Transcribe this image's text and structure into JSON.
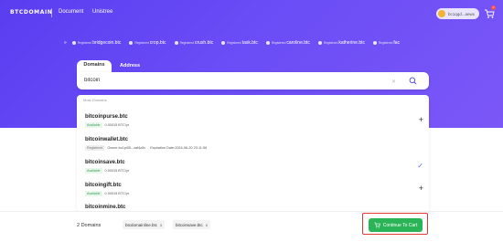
{
  "nav": {
    "logo": "BTCDOMAIN",
    "links": [
      "Document",
      "Unistree"
    ],
    "wallet": "bc1qqd...aewx",
    "cart_count": "2"
  },
  "ticker": {
    "start_mark": "»",
    "prefix": "Registered",
    "names": [
      "bridgecoin.btc",
      "crop.btc",
      "crush.btc",
      "task.btc",
      "caroline.btc",
      "katherine.btc",
      "fac"
    ]
  },
  "tabs": [
    "Domains",
    "Address"
  ],
  "search": {
    "value": "bitcoin",
    "clear_icon": "close-icon",
    "search_icon": "magnifier-icon"
  },
  "results": {
    "header": "Most Domains",
    "rows": [
      {
        "name": "bitcoinpurse.btc",
        "tag": "Available",
        "meta": [
          "0.00015 BTC/yr"
        ],
        "action": "+"
      },
      {
        "name": "bitcoinwallet.btc",
        "tag": "Registered",
        "meta": [
          "Owner:bc1p4l5...zaf4z6v",
          "Expiration Date:2024-06-20 23:11:56"
        ],
        "action": ""
      },
      {
        "name": "bitcoinsave.btc",
        "tag": "Available",
        "meta": [
          "0.00015 BTC/yr"
        ],
        "action": "✓"
      },
      {
        "name": "bitcoingift.btc",
        "tag": "Available",
        "meta": [
          "0.00015 BTC/yr"
        ],
        "action": "+"
      },
      {
        "name": "bitcoinmine.btc",
        "tag": "",
        "meta": [],
        "action": ""
      }
    ]
  },
  "bottom": {
    "count": "2 Domains",
    "chips": [
      "btcdomainline.btc",
      "bitcoinsave.btc"
    ],
    "chip_remove": "x",
    "cta": "Continue To Cart"
  },
  "colors": {
    "hero": "#5a3df0",
    "cta": "#2bb457",
    "highlight": "#e53935",
    "check": "#4b73f5"
  }
}
